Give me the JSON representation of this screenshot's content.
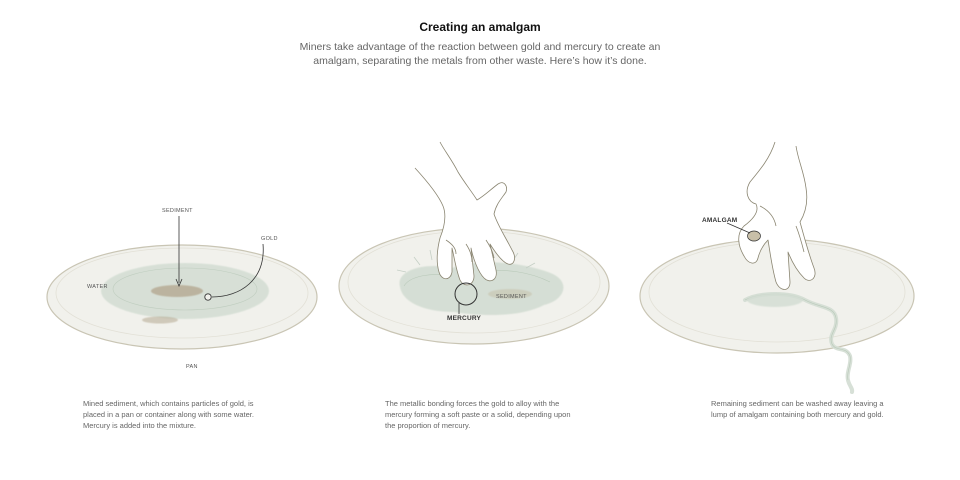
{
  "title": "Creating an amalgam",
  "subtitle": "Miners take advantage of the reaction between gold and mercury to create an amalgam, separating the metals from other waste. Here’s how it’s done.",
  "panels": [
    {
      "labels": {
        "sediment": "SEDIMENT",
        "gold": "GOLD",
        "water": "WATER",
        "pan": "PAN"
      },
      "caption": "Mined sediment, which contains particles of gold, is placed in a pan or container along with some water. Mercury is added into the mixture."
    },
    {
      "labels": {
        "sediment": "SEDIMENT",
        "mercury": "MERCURY"
      },
      "caption": "The metallic bonding forces the gold to alloy with the mercury forming a soft paste or a solid, depending upon the proportion of mercury."
    },
    {
      "labels": {
        "amalgam": "AMALGAM"
      },
      "caption": "Remaining sediment can be washed away leaving a lump of amalgam containing both mercury and gold."
    }
  ],
  "colors": {
    "pan_fill": "#f1f1ec",
    "pan_stroke": "#c9c5b4",
    "water_fill": "#d3ddd3",
    "sediment": "#b5a992",
    "line": "#333333"
  }
}
